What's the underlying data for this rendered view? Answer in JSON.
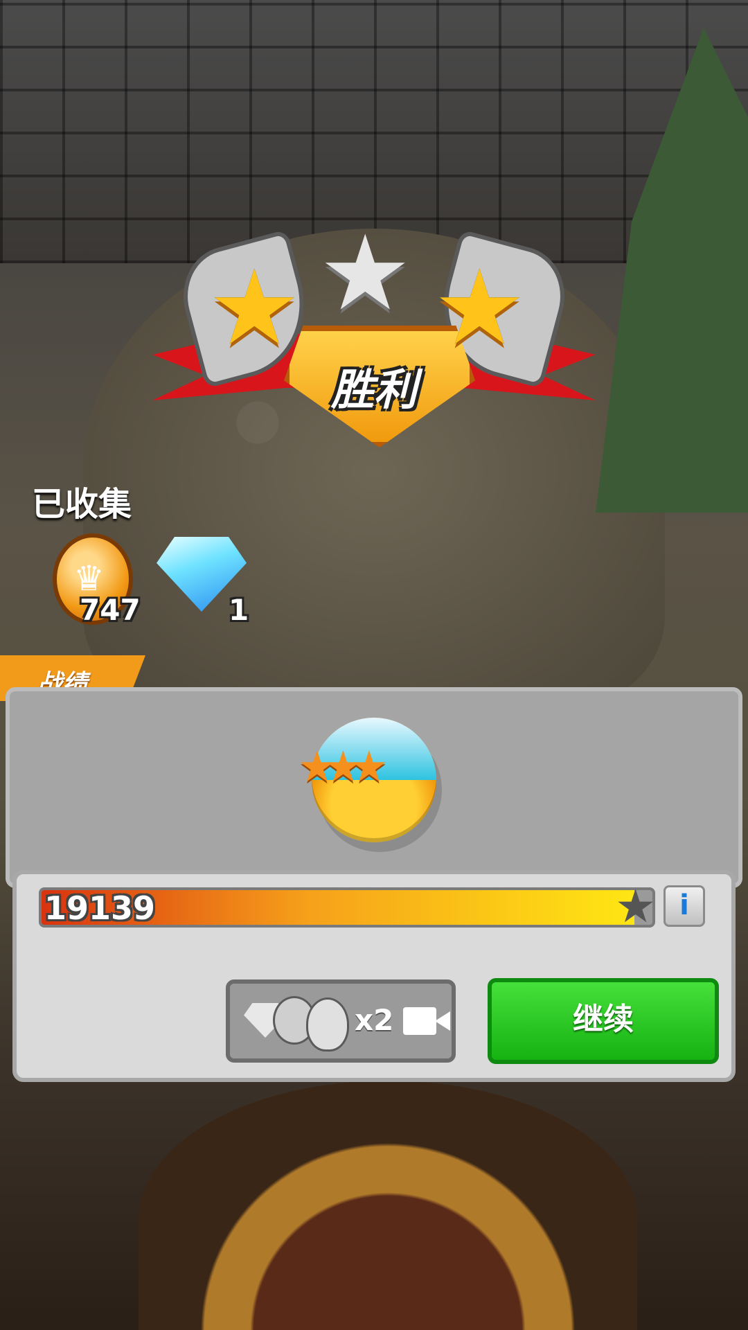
{
  "banner": {
    "title": "胜利",
    "stars_earned": 2,
    "stars_total": 3
  },
  "collected": {
    "title": "已收集",
    "coins": {
      "icon": "crown-coin-icon",
      "count": "747"
    },
    "gems": {
      "icon": "diamond-icon",
      "count": "1"
    }
  },
  "record": {
    "tab_label": "战绩",
    "orb_icon": "three-star-orb-icon",
    "score": "19139",
    "progress_fraction": 0.97,
    "info_label": "i"
  },
  "actions": {
    "double_reward_label": "x2",
    "double_reward_icons": [
      "diamond-icon",
      "crown-coin-icon",
      "potion-icon",
      "video-camera-icon"
    ],
    "continue_label": "继续"
  },
  "colors": {
    "continue": "#1fc41a",
    "progress_start": "#d9330f",
    "progress_end": "#ffe613",
    "tab": "#f29b1a"
  }
}
